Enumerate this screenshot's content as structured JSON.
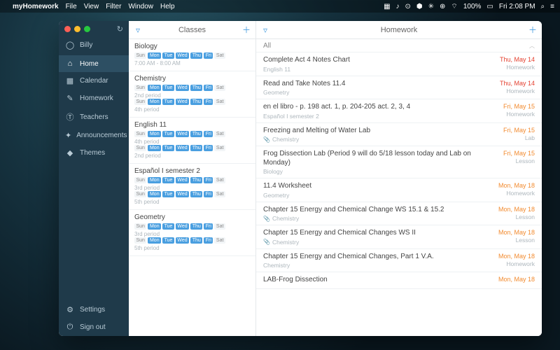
{
  "menubar": {
    "app": "myHomework",
    "items": [
      "File",
      "View",
      "Filter",
      "Window",
      "Help"
    ],
    "battery_pct": "100%",
    "clock": "Fri 2:08 PM"
  },
  "sidebar": {
    "user": "Billy",
    "items": [
      {
        "icon": "⌂",
        "label": "Home"
      },
      {
        "icon": "▦",
        "label": "Calendar"
      },
      {
        "icon": "✎",
        "label": "Homework"
      },
      {
        "icon": "Ⓣ",
        "label": "Teachers"
      },
      {
        "icon": "✦",
        "label": "Announcements"
      },
      {
        "icon": "◆",
        "label": "Themes"
      }
    ],
    "bottom": [
      {
        "icon": "⚙",
        "label": "Settings"
      },
      {
        "icon": "⏻",
        "label": "Sign out"
      }
    ],
    "active": "Home"
  },
  "days_short": [
    "Sun",
    "Mon",
    "Tue",
    "Wed",
    "Thu",
    "Fri",
    "Sat"
  ],
  "classes_col": {
    "title": "Classes"
  },
  "classes": [
    {
      "name": "Biology",
      "rows": [
        {
          "on": [
            1,
            2,
            3,
            4,
            5
          ],
          "sub": "7:00 AM - 8:00 AM"
        }
      ]
    },
    {
      "name": "Chemistry",
      "rows": [
        {
          "on": [
            1,
            2,
            3,
            4,
            5
          ],
          "sub": "2nd period"
        },
        {
          "on": [
            1,
            2,
            3,
            4,
            5
          ],
          "sub": "4th period"
        }
      ]
    },
    {
      "name": "English 11",
      "rows": [
        {
          "on": [
            1,
            2,
            3,
            4,
            5
          ],
          "sub": "4th period"
        },
        {
          "on": [
            1,
            2,
            3,
            4,
            5
          ],
          "sub": "2nd period"
        }
      ]
    },
    {
      "name": "Español I semester 2",
      "rows": [
        {
          "on": [
            1,
            2,
            3,
            4,
            5
          ],
          "sub": "3rd period"
        },
        {
          "on": [
            1,
            2,
            3,
            4,
            5
          ],
          "sub": "5th period"
        }
      ]
    },
    {
      "name": "Geometry",
      "rows": [
        {
          "on": [
            1,
            2,
            3,
            4,
            5
          ],
          "sub": "3rd period"
        },
        {
          "on": [
            1,
            2,
            3,
            4,
            5
          ],
          "sub": "5th period"
        }
      ]
    }
  ],
  "homework_col": {
    "title": "Homework",
    "all_label": "All"
  },
  "homework": [
    {
      "title": "Complete Act 4 Notes Chart",
      "subject": "English 11",
      "clip": false,
      "date": "Thu, May 14",
      "color": "red",
      "type": "Homework"
    },
    {
      "title": "Read and Take Notes 11.4",
      "subject": "Geometry",
      "clip": false,
      "date": "Thu, May 14",
      "color": "red",
      "type": "Homework"
    },
    {
      "title": "en el libro - p. 198 act. 1, p. 204-205 act. 2, 3, 4",
      "subject": "Español I semester 2",
      "clip": false,
      "date": "Fri, May 15",
      "color": "orange",
      "type": "Homework"
    },
    {
      "title": "Freezing and Melting of Water Lab",
      "subject": "Chemistry",
      "clip": true,
      "date": "Fri, May 15",
      "color": "orange",
      "type": "Lab"
    },
    {
      "title": "Frog Dissection Lab (Period 9 will do 5/18 lesson today and Lab on Monday)",
      "subject": "Biology",
      "clip": false,
      "date": "Fri, May 15",
      "color": "orange",
      "type": "Lesson"
    },
    {
      "title": "11.4 Worksheet",
      "subject": "Geometry",
      "clip": false,
      "date": "Mon, May 18",
      "color": "orange",
      "type": "Homework"
    },
    {
      "title": "Chapter 15 Energy and Chemical Change WS 15.1 & 15.2",
      "subject": "Chemistry",
      "clip": true,
      "date": "Mon, May 18",
      "color": "orange",
      "type": "Lesson"
    },
    {
      "title": "Chapter 15 Energy and Chemical Changes WS II",
      "subject": "Chemistry",
      "clip": true,
      "date": "Mon, May 18",
      "color": "orange",
      "type": "Lesson"
    },
    {
      "title": "Chapter 15 Energy and Chemical Changes, Part 1 V.A.",
      "subject": "Chemistry",
      "clip": false,
      "date": "Mon, May 18",
      "color": "orange",
      "type": "Homework"
    },
    {
      "title": "LAB-Frog Dissection",
      "subject": "",
      "clip": false,
      "date": "Mon, May 18",
      "color": "orange",
      "type": ""
    }
  ]
}
